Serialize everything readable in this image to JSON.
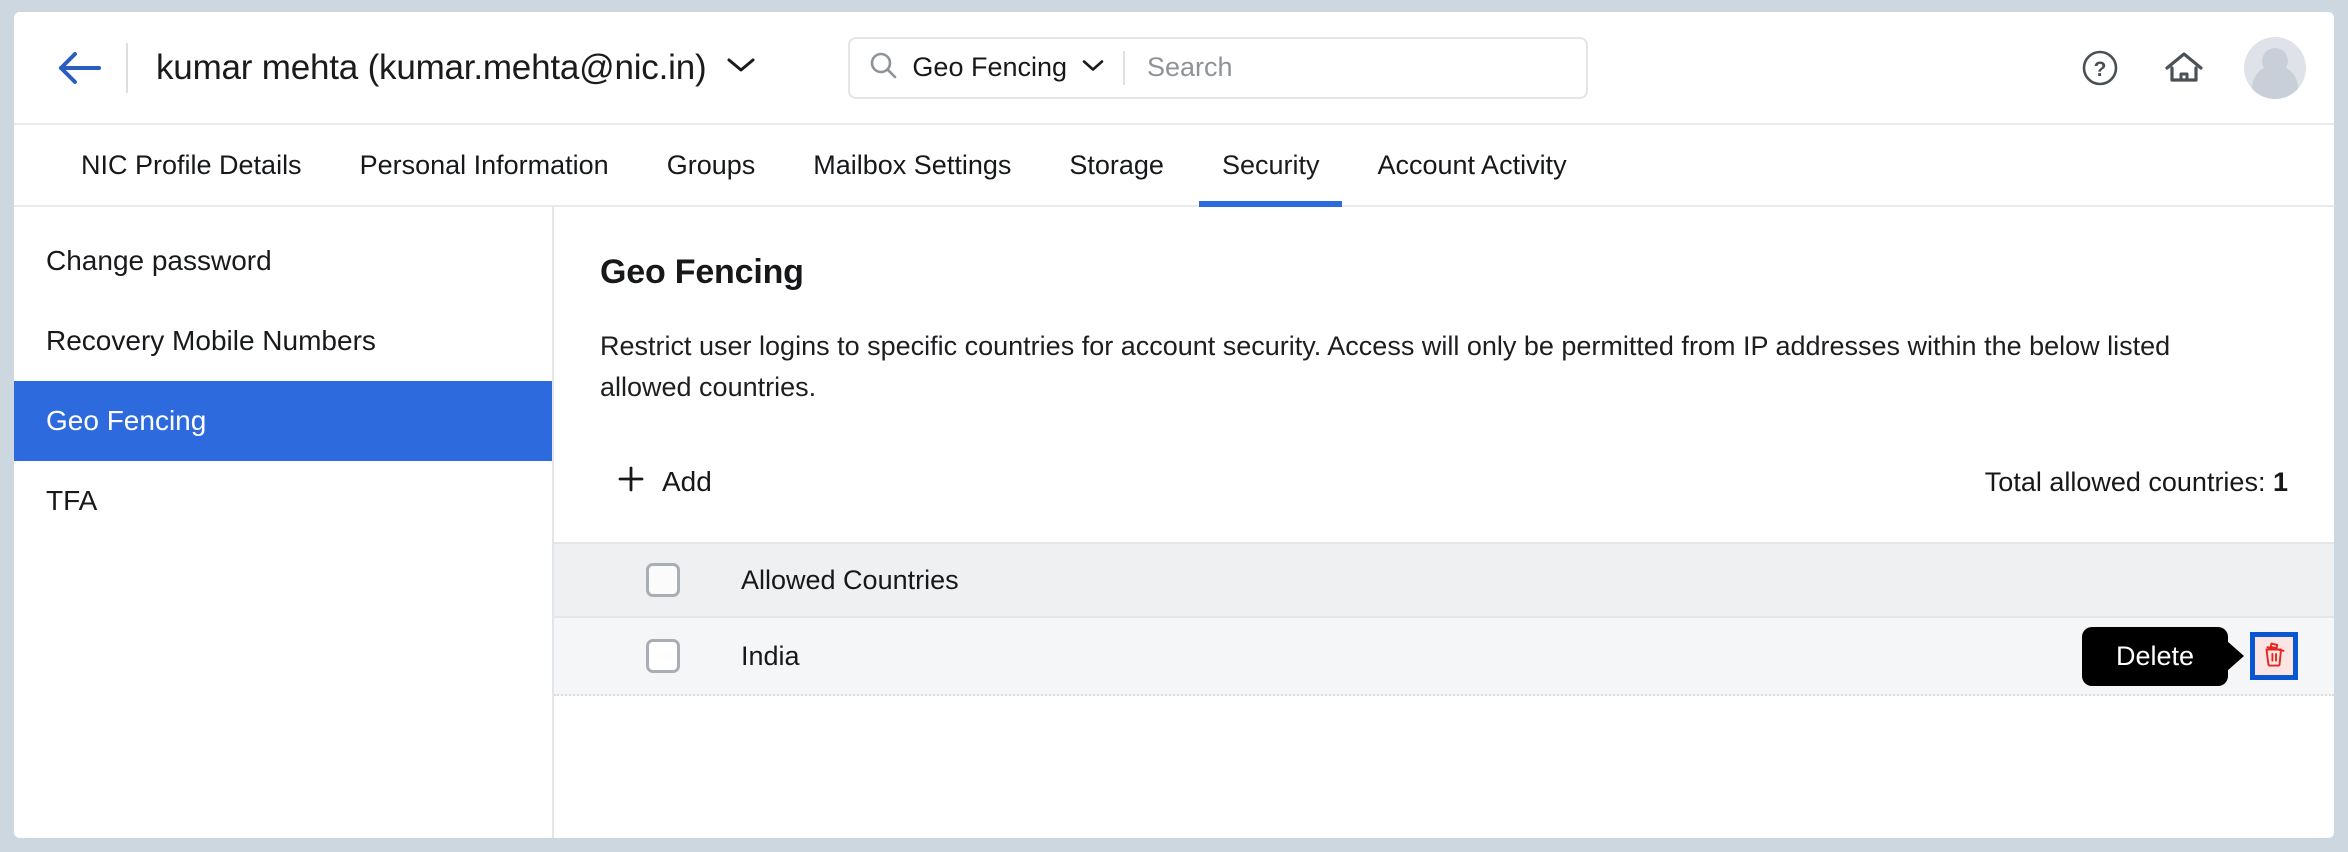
{
  "header": {
    "back_icon": "back-arrow-icon",
    "account_name": "kumar mehta (kumar.mehta@nic.in)",
    "account_chevron_icon": "chevron-down-icon",
    "search": {
      "search_icon": "search-icon",
      "scope_label": "Geo Fencing",
      "scope_chevron_icon": "chevron-down-icon",
      "placeholder": "Search",
      "value": ""
    },
    "help_icon": "help-circle-icon",
    "home_icon": "home-icon",
    "avatar_icon": "avatar-icon"
  },
  "tabs": [
    {
      "label": "NIC Profile Details",
      "active": false
    },
    {
      "label": "Personal Information",
      "active": false
    },
    {
      "label": "Groups",
      "active": false
    },
    {
      "label": "Mailbox Settings",
      "active": false
    },
    {
      "label": "Storage",
      "active": false
    },
    {
      "label": "Security",
      "active": true
    },
    {
      "label": "Account Activity",
      "active": false
    }
  ],
  "sidebar": {
    "items": [
      {
        "label": "Change password",
        "active": false
      },
      {
        "label": "Recovery Mobile Numbers",
        "active": false
      },
      {
        "label": "Geo Fencing",
        "active": true
      },
      {
        "label": "TFA",
        "active": false
      }
    ]
  },
  "main": {
    "title": "Geo Fencing",
    "description": "Restrict user logins to specific countries for account security. Access will only be permitted from IP addresses within the below listed allowed countries.",
    "add_label": "Add",
    "add_icon": "plus-icon",
    "total_label": "Total allowed countries:",
    "total_value": "1",
    "table": {
      "select_all_checkbox": "checkbox-unchecked",
      "column_header": "Allowed Countries",
      "rows": [
        {
          "checkbox": "checkbox-unchecked",
          "country": "India",
          "tooltip": "Delete",
          "delete_icon": "trash-icon"
        }
      ]
    }
  },
  "colors": {
    "accent_blue": "#2d6ade",
    "back_arrow_blue": "#2a5dbd",
    "focus_ring_blue": "#0a55d0",
    "delete_red": "#e8251f",
    "delete_bg_pink": "#fbe4e4",
    "tooltip_bg": "#000000",
    "frame_grey": "#ccd7e0",
    "table_header_bg": "#eef0f2",
    "table_row_bg": "#f5f6f7"
  }
}
